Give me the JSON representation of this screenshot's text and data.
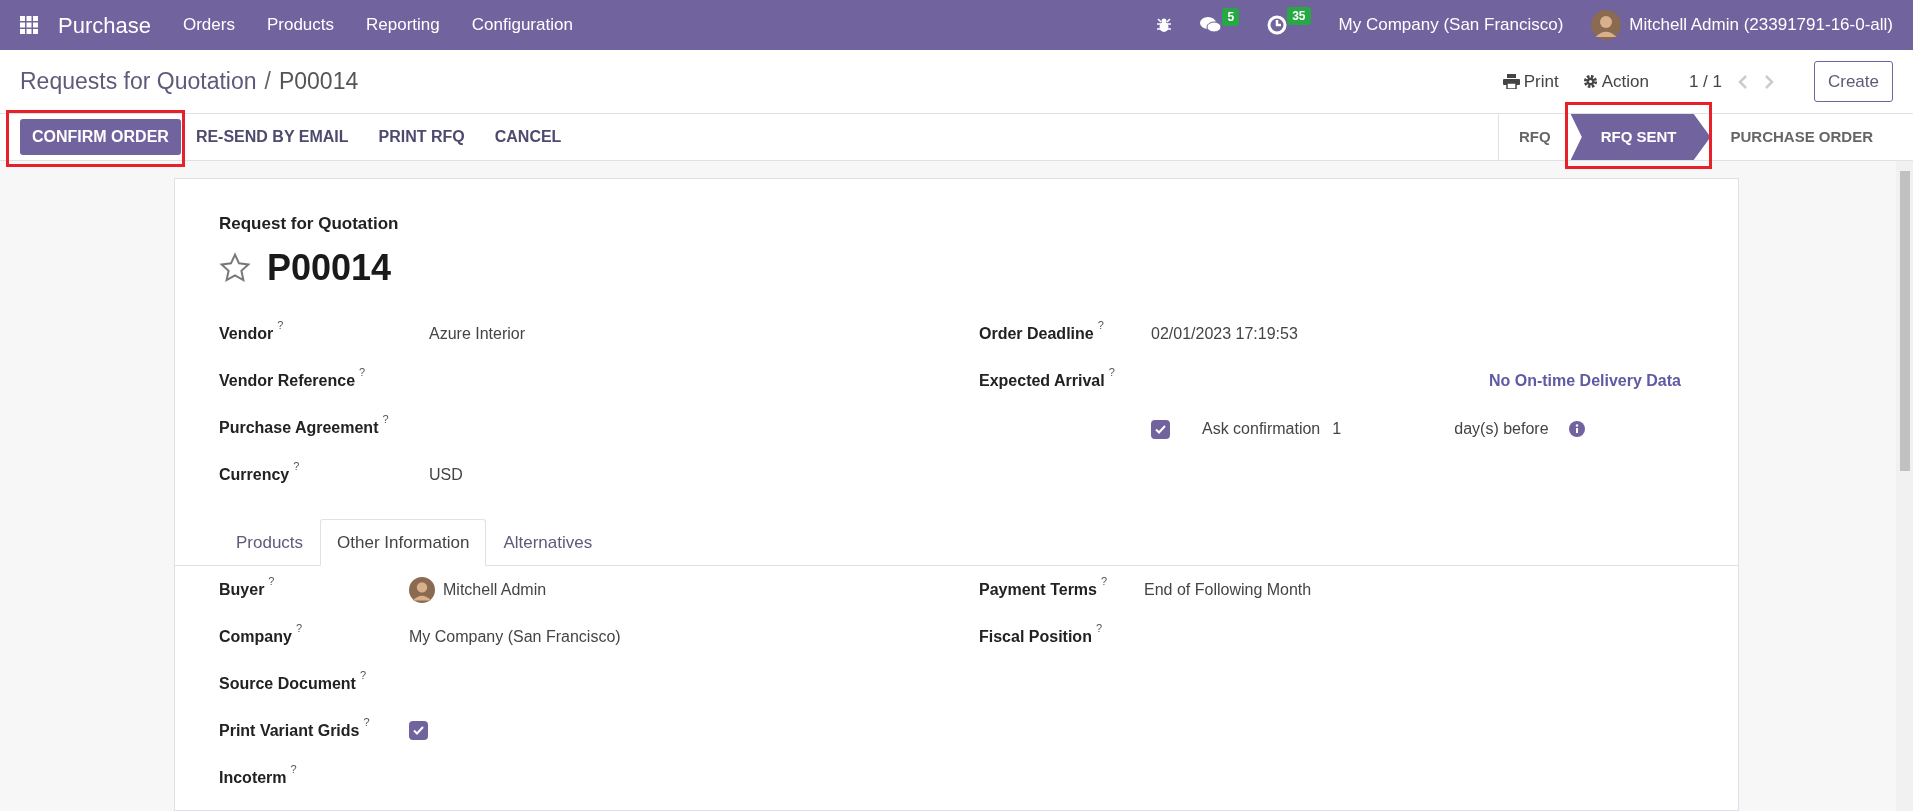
{
  "navbar": {
    "app": "Purchase",
    "menu": [
      "Orders",
      "Products",
      "Reporting",
      "Configuration"
    ],
    "messages_badge": "5",
    "activities_badge": "35",
    "company": "My Company (San Francisco)",
    "user": "Mitchell Admin (23391791-16-0-all)"
  },
  "breadcrumb": {
    "parent": "Requests for Quotation",
    "separator": "/",
    "current": "P00014"
  },
  "controls": {
    "print": "Print",
    "action": "Action",
    "pager": "1 / 1",
    "create": "Create"
  },
  "buttons": [
    {
      "label": "CONFIRM ORDER",
      "kind": "primary",
      "highlighted": true
    },
    {
      "label": "RE-SEND BY EMAIL",
      "kind": "link",
      "highlighted": false
    },
    {
      "label": "PRINT RFQ",
      "kind": "link",
      "highlighted": false
    },
    {
      "label": "CANCEL",
      "kind": "link",
      "highlighted": false
    }
  ],
  "stages": [
    {
      "label": "RFQ",
      "selected": false,
      "highlighted": false
    },
    {
      "label": "RFQ SENT",
      "selected": true,
      "highlighted": true
    },
    {
      "label": "PURCHASE ORDER",
      "selected": false,
      "highlighted": false
    }
  ],
  "form": {
    "subtitle": "Request for Quotation",
    "title": "P00014",
    "starred": false,
    "left_fields": [
      {
        "label": "Vendor",
        "help": "?",
        "kind": "text",
        "value": "Azure Interior"
      },
      {
        "label": "Vendor Reference",
        "help": "?",
        "kind": "empty"
      },
      {
        "label": "Purchase Agreement",
        "help": "?",
        "kind": "empty"
      },
      {
        "label": "Currency",
        "help": "?",
        "kind": "text",
        "value": "USD"
      }
    ],
    "right_fields": [
      {
        "label": "Order Deadline",
        "help": "?",
        "kind": "text",
        "value": "02/01/2023 17:19:53"
      },
      {
        "label": "Expected Arrival",
        "help": "?",
        "kind": "link",
        "value": "No On-time Delivery Data"
      }
    ],
    "ask_confirmation": {
      "checked": true,
      "label": "Ask confirmation",
      "days": "1",
      "suffix": "day(s) before"
    },
    "tabs": [
      {
        "label": "Products",
        "selected": false
      },
      {
        "label": "Other Information",
        "selected": true
      },
      {
        "label": "Alternatives",
        "selected": false
      }
    ],
    "other_left": [
      {
        "label": "Buyer",
        "help": "?",
        "kind": "user",
        "value": "Mitchell Admin"
      },
      {
        "label": "Company",
        "help": "?",
        "kind": "text",
        "value": "My Company (San Francisco)"
      },
      {
        "label": "Source Document",
        "help": "?",
        "kind": "empty"
      },
      {
        "label": "Print Variant Grids",
        "help": "?",
        "kind": "checkbox",
        "checked": true
      },
      {
        "label": "Incoterm",
        "help": "?",
        "kind": "empty"
      }
    ],
    "other_right": [
      {
        "label": "Payment Terms",
        "help": "?",
        "kind": "text",
        "value": "End of Following Month"
      },
      {
        "label": "Fiscal Position",
        "help": "?",
        "kind": "empty"
      }
    ]
  }
}
